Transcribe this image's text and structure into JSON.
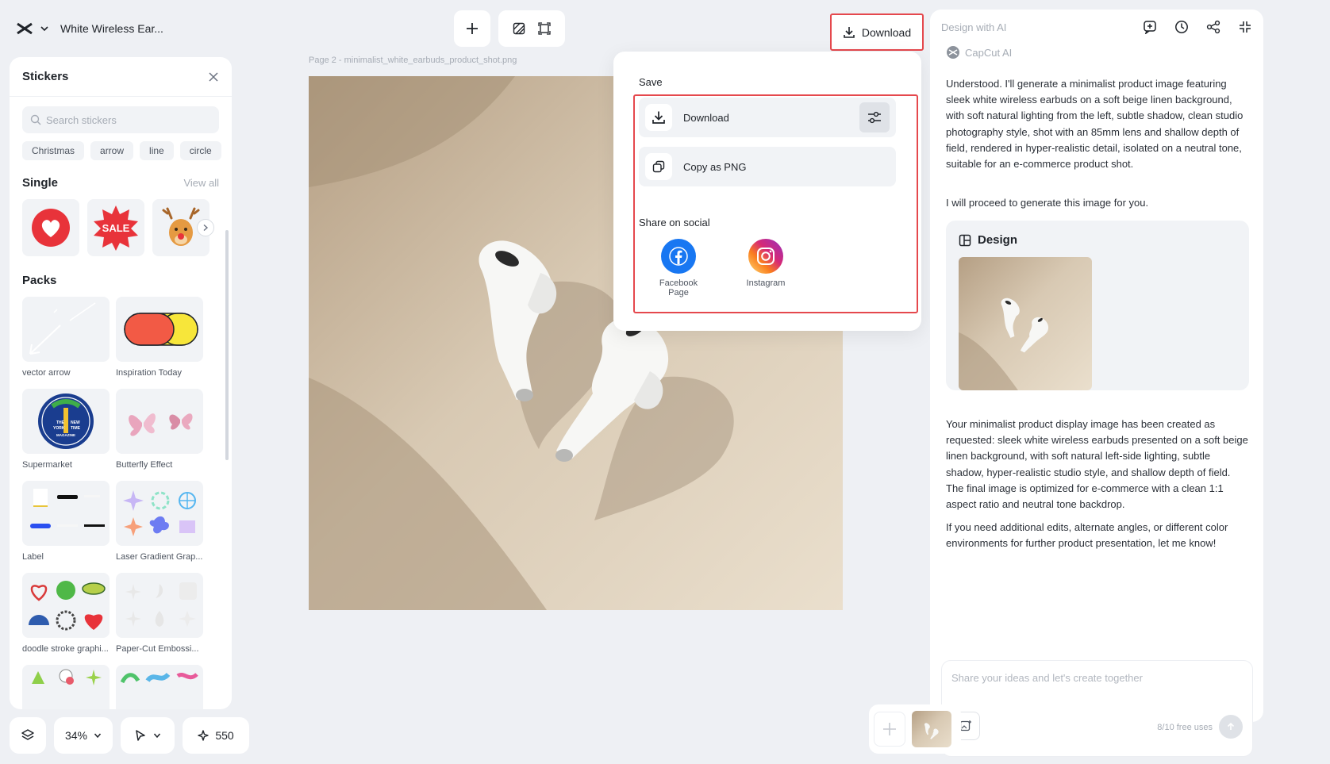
{
  "project": {
    "title": "White Wireless Ear..."
  },
  "stickers": {
    "title": "Stickers",
    "search_placeholder": "Search stickers",
    "tags": [
      "Christmas",
      "arrow",
      "line",
      "circle"
    ],
    "single_title": "Single",
    "view_all": "View all",
    "packs_title": "Packs",
    "packs": [
      {
        "label": "vector arrow"
      },
      {
        "label": "Inspiration Today"
      },
      {
        "label": "Supermarket"
      },
      {
        "label": "Butterfly Effect"
      },
      {
        "label": "Label"
      },
      {
        "label": "Laser Gradient Grap..."
      },
      {
        "label": "doodle stroke graphi..."
      },
      {
        "label": "Paper-Cut Embossi..."
      }
    ],
    "sale_text": "SALE",
    "badge_lines": [
      "THE",
      "NEW",
      "YORK",
      "TIME",
      "MAGAZINE"
    ]
  },
  "bottom_toolbar": {
    "zoom": "34%",
    "credits": "550"
  },
  "canvas": {
    "page_label": "Page 2 -  minimalist_white_earbuds_product_shot.png"
  },
  "download": {
    "button_label": "Download",
    "save_label": "Save",
    "download_label": "Download",
    "copy_label": "Copy as PNG",
    "share_label": "Share on social",
    "facebook_line1": "Facebook",
    "facebook_line2": "Page",
    "instagram_label": "Instagram"
  },
  "ai": {
    "title": "Design with AI",
    "brand": "CapCut AI",
    "message1": "Understood. I'll generate a minimalist product image featuring sleek white wireless earbuds on a soft beige linen background, with soft natural lighting from the left, subtle shadow, clean studio photography style, shot with an 85mm lens and shallow depth of field, rendered in hyper-realistic detail, isolated on a neutral tone, suitable for an e-commerce product shot.",
    "message2": "I will proceed to generate this image for you.",
    "design_label": "Design",
    "message3": "Your minimalist product display image has been created as requested: sleek white wireless earbuds presented on a soft beige linen background, with soft natural left-side lighting, subtle shadow, hyper-realistic studio style, and shallow depth of field. The final image is optimized for e-commerce with a clean 1:1 aspect ratio and neutral tone backdrop.",
    "message4": "If you need additional edits, alternate angles, or different color environments for further product presentation, let me know!",
    "input_placeholder": "Share your ideas and let's create together",
    "uses": "8/10 free uses"
  },
  "colors": {
    "accent_red": "#e5484d",
    "facebook": "#1877f2"
  }
}
